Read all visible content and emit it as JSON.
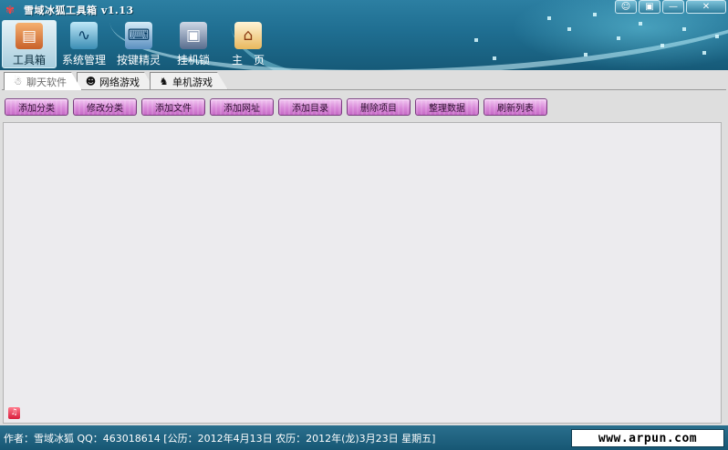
{
  "window": {
    "title": "雪域冰狐工具箱  v1.13",
    "app_icon": "fox-icon",
    "controls": {
      "skin": "☺",
      "minimize_to_tray": "▣",
      "minimize": "—",
      "close": "✕"
    }
  },
  "toolbar": {
    "items": [
      {
        "label": "工具箱",
        "icon": "toolbox-icon",
        "active": true
      },
      {
        "label": "系统管理",
        "icon": "monitor-icon",
        "active": false
      },
      {
        "label": "按键精灵",
        "icon": "keyboard-icon",
        "active": false
      },
      {
        "label": "挂机锁",
        "icon": "lock-computer-icon",
        "active": false
      },
      {
        "label": "主　页",
        "icon": "home-icon",
        "active": false
      }
    ]
  },
  "tabs": [
    {
      "label": "聊天软件",
      "icon": "qq-penguin-icon",
      "active": true
    },
    {
      "label": "网络游戏",
      "icon": "person-icon",
      "active": false
    },
    {
      "label": "单机游戏",
      "icon": "chess-icon",
      "active": false
    }
  ],
  "actions": [
    "添加分类",
    "修改分类",
    "添加文件",
    "添加网址",
    "添加目录",
    "删除项目",
    "整理数据",
    "刷新列表"
  ],
  "statusbar": {
    "text": "作者：雪域冰狐 QQ：463018614 [公历：2012年4月13日 农历：2012年(龙)3月23日 星期五]",
    "website": "www.arpun.com"
  },
  "colors": {
    "header": "#1f6e91",
    "action_button": "#d98ad9",
    "panel": "#ecebee",
    "status": "#175774"
  }
}
